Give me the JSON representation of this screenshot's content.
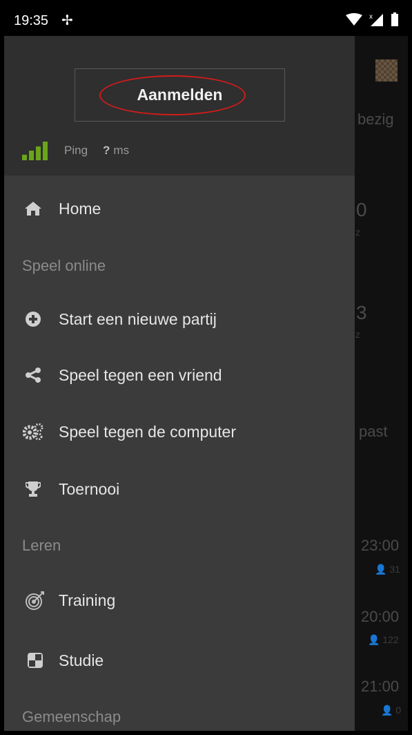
{
  "status_bar": {
    "time": "19:35"
  },
  "drawer": {
    "login_label": "Aanmelden",
    "ping": {
      "label": "Ping",
      "value": "?",
      "unit": "ms"
    },
    "items": [
      {
        "label": "Home",
        "icon": "home-icon"
      },
      {
        "label": "Start een nieuwe partij",
        "icon": "plus-circle-icon"
      },
      {
        "label": "Speel tegen een vriend",
        "icon": "share-icon"
      },
      {
        "label": "Speel tegen de computer",
        "icon": "cogs-icon"
      },
      {
        "label": "Toernooi",
        "icon": "trophy-icon"
      },
      {
        "label": "Training",
        "icon": "target-icon"
      },
      {
        "label": "Studie",
        "icon": "study-icon"
      }
    ],
    "sections": [
      "Speel online",
      "Leren",
      "Gemeenschap"
    ]
  },
  "background": {
    "t1": "bezig",
    "n1": "0",
    "z1": "z",
    "n2": "3",
    "z2": "z",
    "past": "past",
    "times": [
      "23:00",
      "20:00",
      "21:00"
    ],
    "counts": [
      "31",
      "122",
      "0"
    ]
  },
  "colors": {
    "accent_green": "#6aa51a",
    "highlight_red": "#d21b1b",
    "drawer_bg": "#3b3b3b"
  }
}
